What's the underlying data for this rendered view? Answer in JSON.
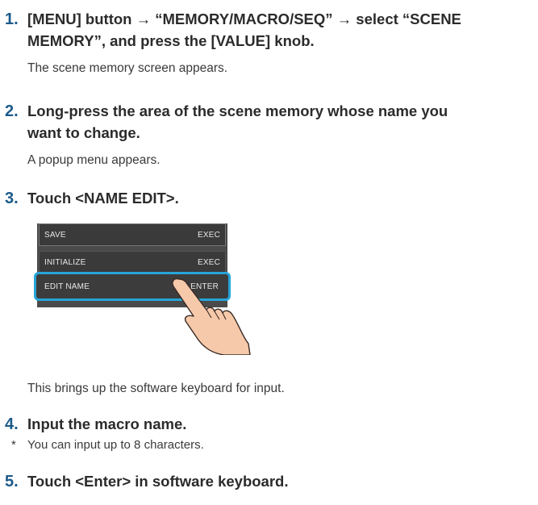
{
  "steps": [
    {
      "number": "1.",
      "heading_line1": "[MENU] button → “MEMORY/MACRO/SEQ” → select “SCENE",
      "heading_line2": "MEMORY”, and press the [VALUE] knob.",
      "description": "The scene memory screen appears."
    },
    {
      "number": "2.",
      "heading_line1": "Long-press the area of the scene memory whose name you",
      "heading_line2": "want to change.",
      "description": "A popup menu appears."
    },
    {
      "number": "3.",
      "heading_line1": "Touch <NAME EDIT>.",
      "description": "This brings up the software keyboard for input."
    },
    {
      "number": "4.",
      "heading_line1": "Input the macro name.",
      "note_marker": "*",
      "note": "You can input up to 8 characters."
    },
    {
      "number": "5.",
      "heading_line1": "Touch <Enter> in software keyboard."
    }
  ],
  "popup_menu": {
    "rows": [
      {
        "label": "SAVE",
        "value": "EXEC"
      },
      {
        "label": "INITIALIZE",
        "value": "EXEC"
      },
      {
        "label": "EDIT NAME",
        "value": "ENTER"
      }
    ],
    "highlight_color": "#27a5d8"
  },
  "colors": {
    "step_number": "#1b5a8a"
  }
}
